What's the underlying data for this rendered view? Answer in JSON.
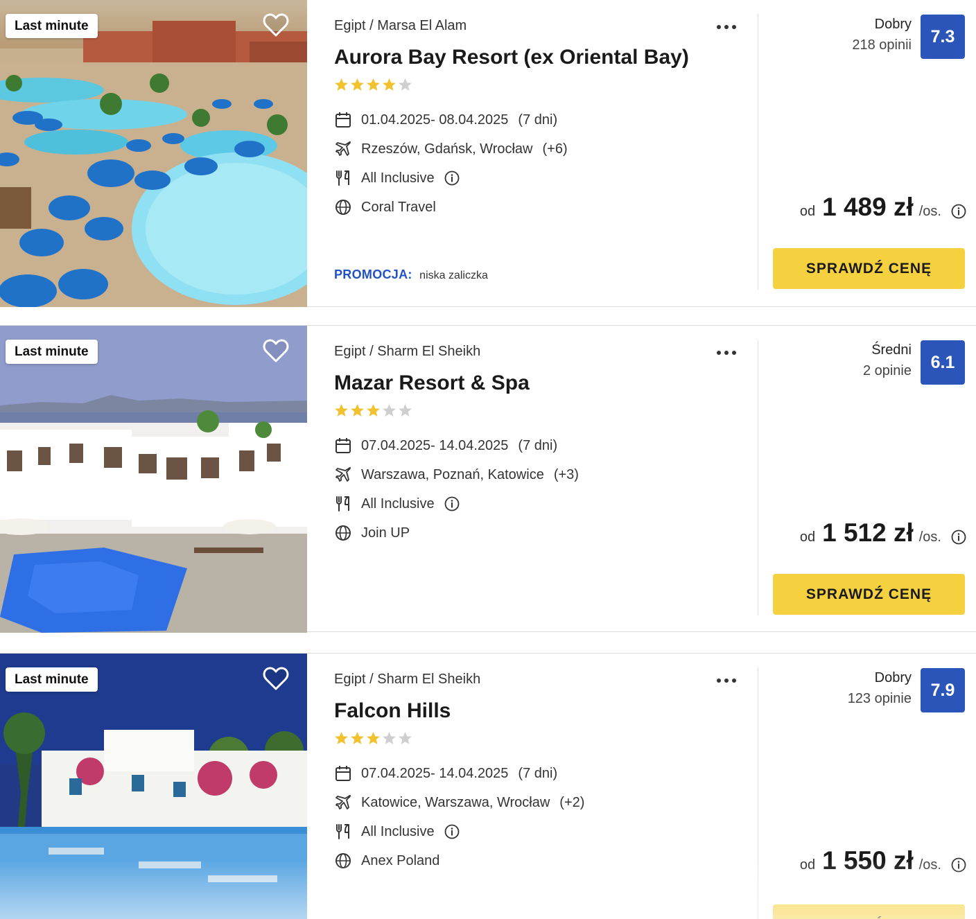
{
  "offers": [
    {
      "badge": "Last minute",
      "location": "Egipt / Marsa El Alam",
      "name": "Aurora Bay Resort (ex Oriental Bay)",
      "stars": 4,
      "dates": "01.04.2025- 08.04.2025",
      "duration": "(7 dni)",
      "departures": "Rzeszów, Gdańsk, Wrocław",
      "departures_more": "(+6)",
      "board": "All Inclusive",
      "operator": "Coral Travel",
      "promo_label": "PROMOCJA:",
      "promo_text": "niska zaliczka",
      "rating_word": "Dobry",
      "rating_count": "218 opinii",
      "score": "7.3",
      "price_prefix": "od",
      "price": "1 489 zł",
      "price_unit": "/os.",
      "cta": "SPRAWDŹ CENĘ"
    },
    {
      "badge": "Last minute",
      "location": "Egipt / Sharm El Sheikh",
      "name": "Mazar Resort & Spa",
      "stars": 3,
      "dates": "07.04.2025- 14.04.2025",
      "duration": "(7 dni)",
      "departures": "Warszawa, Poznań, Katowice",
      "departures_more": "(+3)",
      "board": "All Inclusive",
      "operator": "Join UP",
      "rating_word": "Średni",
      "rating_count": "2 opinie",
      "score": "6.1",
      "price_prefix": "od",
      "price": "1 512 zł",
      "price_unit": "/os.",
      "cta": "SPRAWDŹ CENĘ"
    },
    {
      "badge": "Last minute",
      "location": "Egipt / Sharm El Sheikh",
      "name": "Falcon Hills",
      "stars": 3,
      "dates": "07.04.2025- 14.04.2025",
      "duration": "(7 dni)",
      "departures": "Katowice, Warszawa, Wrocław",
      "departures_more": "(+2)",
      "board": "All Inclusive",
      "operator": "Anex Poland",
      "rating_word": "Dobry",
      "rating_count": "123 opinie",
      "score": "7.9",
      "price_prefix": "od",
      "price": "1 550 zł",
      "price_unit": "/os.",
      "cta": "SPRAWDŹ CENĘ"
    }
  ],
  "colors": {
    "accent_blue": "#2c55b9",
    "promo_blue": "#2152c2",
    "cta_yellow": "#f5d140",
    "star_gold": "#f2c12e",
    "star_empty": "#cfcfcf"
  },
  "icons": [
    "heart-icon",
    "more-icon",
    "calendar-icon",
    "plane-icon",
    "cutlery-icon",
    "info-icon",
    "globe-icon",
    "star-icon"
  ]
}
